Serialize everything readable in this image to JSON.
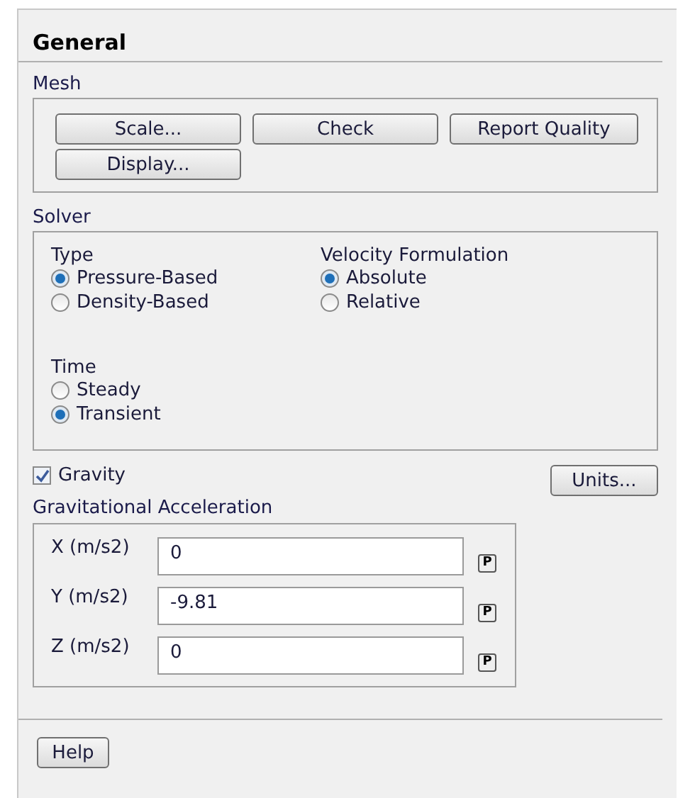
{
  "title": "General",
  "mesh": {
    "label": "Mesh",
    "buttons": [
      "Scale...",
      "Check",
      "Report Quality",
      "Display..."
    ]
  },
  "solver": {
    "label": "Solver",
    "groups": [
      {
        "label": "Type",
        "options": [
          {
            "label": "Pressure-Based",
            "selected": true
          },
          {
            "label": "Density-Based",
            "selected": false
          }
        ]
      },
      {
        "label": "Velocity Formulation",
        "options": [
          {
            "label": "Absolute",
            "selected": true
          },
          {
            "label": "Relative",
            "selected": false
          }
        ]
      },
      {
        "label": "Time",
        "options": [
          {
            "label": "Steady",
            "selected": false
          },
          {
            "label": "Transient",
            "selected": true
          }
        ]
      }
    ]
  },
  "gravity": {
    "label": "Gravity",
    "checked": true
  },
  "units_button": "Units...",
  "acceleration": {
    "label": "Gravitational Acceleration",
    "fields": [
      {
        "label": "X (m/s2)",
        "value": "0",
        "param": "P"
      },
      {
        "label": "Y (m/s2)",
        "value": "-9.81",
        "param": "P"
      },
      {
        "label": "Z (m/s2)",
        "value": "0",
        "param": "P"
      }
    ]
  },
  "help_button": "Help"
}
